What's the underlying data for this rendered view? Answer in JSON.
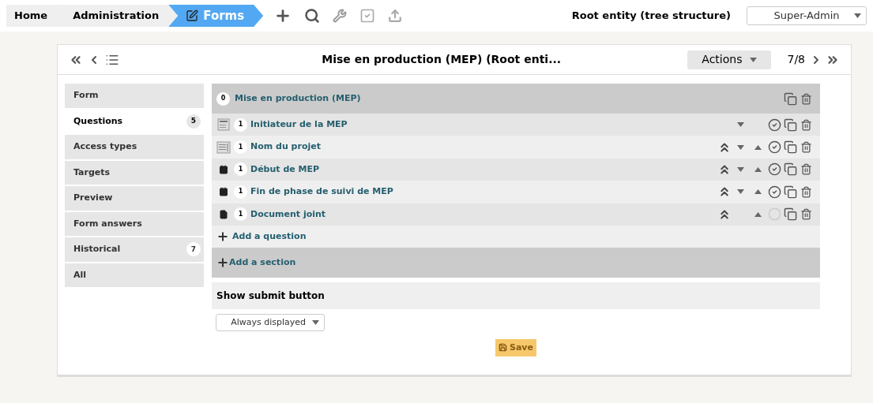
{
  "breadcrumb": [
    {
      "label": "Home",
      "selected": false
    },
    {
      "label": "Administration",
      "selected": false
    },
    {
      "label": "Forms",
      "selected": true
    }
  ],
  "entity": {
    "label": "Root entity (tree structure)",
    "profile": "Super-Admin"
  },
  "header": {
    "title": "Mise en production (MEP) (Root enti...",
    "actions": "Actions",
    "position": "7/8"
  },
  "tabs": [
    {
      "label": "Form",
      "selected": false
    },
    {
      "label": "Questions",
      "selected": true,
      "badge": "5"
    },
    {
      "label": "Access types",
      "selected": false
    },
    {
      "label": "Targets",
      "selected": false
    },
    {
      "label": "Preview",
      "selected": false
    },
    {
      "label": "Form answers",
      "selected": false
    },
    {
      "label": "Historical",
      "selected": false,
      "badge": "7"
    },
    {
      "label": "All",
      "selected": false
    }
  ],
  "section": {
    "rank": "0",
    "title": "Mise en production (MEP)"
  },
  "questions": [
    {
      "kind": "dropdown",
      "rank": "1",
      "title": "Initiateur de la MEP",
      "move_section": false,
      "down": true,
      "up": false,
      "mandatory": true
    },
    {
      "kind": "text",
      "rank": "1",
      "title": "Nom du projet",
      "move_section": true,
      "down": true,
      "up": true,
      "mandatory": true
    },
    {
      "kind": "date",
      "rank": "1",
      "title": "Début de MEP",
      "move_section": true,
      "down": true,
      "up": true,
      "mandatory": true
    },
    {
      "kind": "date",
      "rank": "1",
      "title": "Fin de phase de suivi de MEP",
      "move_section": true,
      "down": true,
      "up": true,
      "mandatory": true
    },
    {
      "kind": "file",
      "rank": "1",
      "title": "Document joint",
      "move_section": true,
      "down": false,
      "up": true,
      "mandatory": false
    }
  ],
  "add_question": "Add a question",
  "add_section": "Add a section",
  "submit": {
    "label": "Show submit button",
    "value": "Always displayed"
  },
  "save": "Save"
}
